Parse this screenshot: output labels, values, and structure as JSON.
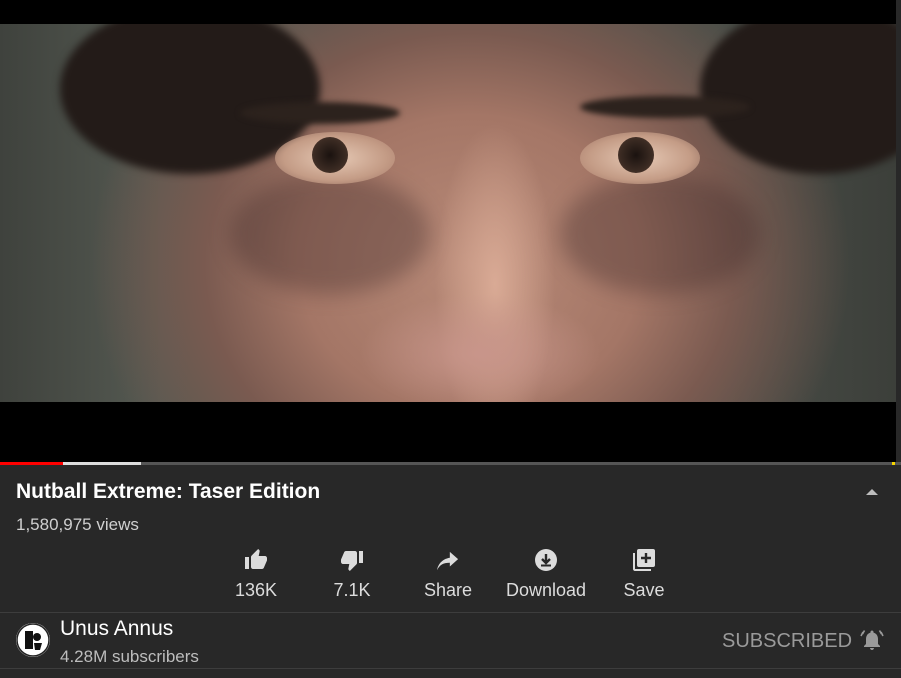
{
  "video": {
    "title": "Nutball Extreme: Taser Edition",
    "views": "1,580,975 views",
    "progress": {
      "played_fraction": 0.07,
      "buffered_fraction": 0.157
    },
    "colors": {
      "played": "#ff0000",
      "buffered": "#dddddd",
      "track": "#555555"
    }
  },
  "actions": [
    {
      "label": "136K",
      "icon": "thumbs-up-icon"
    },
    {
      "label": "7.1K",
      "icon": "thumbs-down-icon"
    },
    {
      "label": "Share",
      "icon": "share-arrow-icon"
    },
    {
      "label": "Download",
      "icon": "download-icon"
    },
    {
      "label": "Save",
      "icon": "add-to-playlist-icon"
    }
  ],
  "channel": {
    "name": "Unus Annus",
    "subscribers": "4.28M subscribers",
    "subscribe_state": "SUBSCRIBED",
    "bell_icon": "notification-bell-icon"
  },
  "theme": {
    "background": "#282828",
    "text": "#ffffff",
    "muted": "#9a9a9a"
  }
}
